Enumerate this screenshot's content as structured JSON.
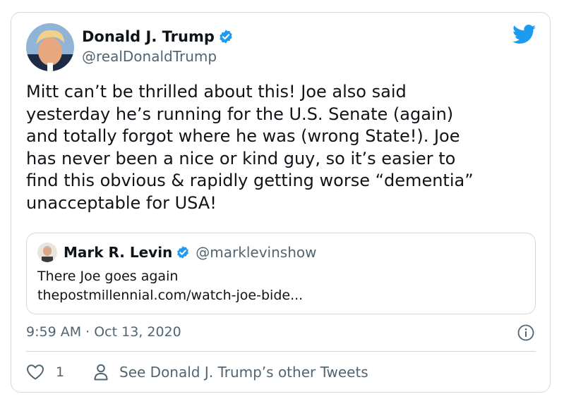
{
  "tweet": {
    "author_name": "Donald J. Trump",
    "author_handle": "@realDonaldTrump",
    "text": "Mitt can’t be thrilled about this! Joe also said\nyesterday he’s running for the U.S. Senate (again)\nand totally forgot where he was (wrong State!). Joe\nhas never been a nice or kind guy, so it’s easier to\nfind this obvious & rapidly getting worse “dementia”\nunacceptable for USA!",
    "timestamp": "9:59 AM · Oct 13, 2020",
    "likes": "1",
    "other_tweets_label": "See Donald J. Trump’s other Tweets"
  },
  "quote": {
    "author_name": "Mark R. Levin",
    "author_handle": "@marklevinshow",
    "text": "There Joe goes again",
    "link": "thepostmillennial.com/watch-joe-bide..."
  },
  "icons": {
    "verified": "verified-badge-icon",
    "brand": "twitter-bird-icon",
    "info": "info-icon",
    "like": "heart-icon",
    "profile": "person-icon"
  },
  "colors": {
    "verified": "#1d9bf0",
    "twitter": "#1d9bf0",
    "secondary_text": "#536471",
    "border": "#cfd9de"
  }
}
